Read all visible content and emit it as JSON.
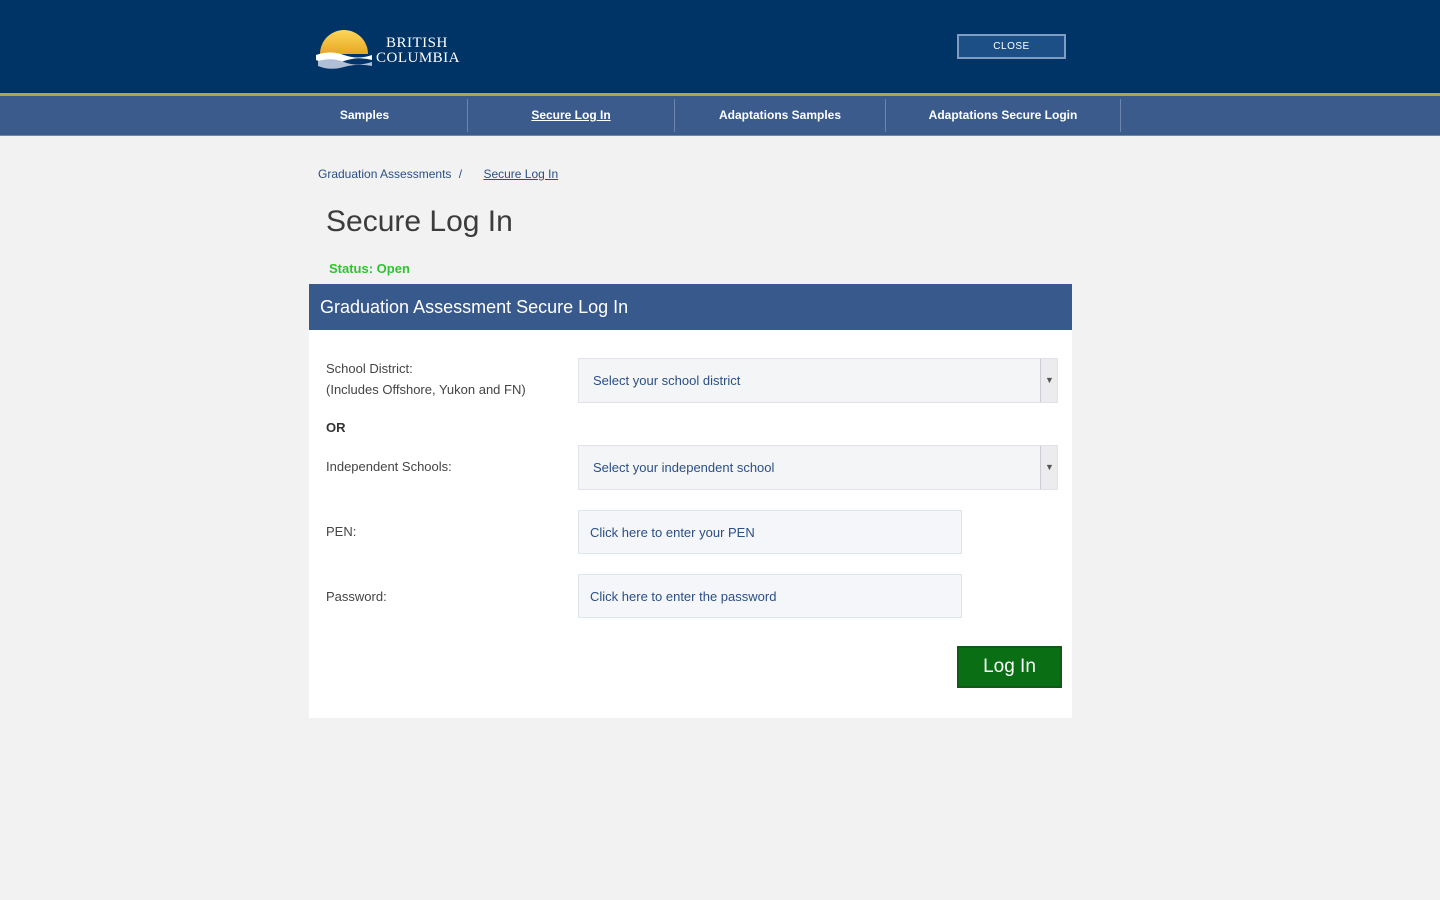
{
  "header": {
    "logo_text_line1": "BRITISH",
    "logo_text_line2": "COLUMBIA",
    "close_label": "CLOSE"
  },
  "nav": {
    "items": [
      {
        "label": "Samples",
        "active": false
      },
      {
        "label": "Secure Log In",
        "active": true
      },
      {
        "label": "Adaptations Samples",
        "active": false
      },
      {
        "label": "Adaptations Secure Login",
        "active": false
      }
    ]
  },
  "breadcrumb": {
    "parent": "Graduation Assessments",
    "separator": "/",
    "current": "Secure Log In"
  },
  "page": {
    "title": "Secure Log In",
    "status": "Status: Open"
  },
  "form": {
    "header": "Graduation Assessment Secure Log In",
    "school_district_label_line1": "School District:",
    "school_district_label_line2": "(Includes Offshore, Yukon and FN)",
    "school_district_value": "Select your school district",
    "or_label": "OR",
    "independent_label": "Independent Schools:",
    "independent_value": "Select your independent school",
    "pen_label": "PEN:",
    "pen_placeholder": "Click here to enter your PEN",
    "password_label": "Password:",
    "password_placeholder": "Click here to enter the password",
    "submit_label": "Log In"
  },
  "colors": {
    "header_bg": "#003366",
    "accent_gold": "#b8a04f",
    "nav_bg": "#3a5b8c",
    "status_green": "#2fc42f",
    "button_green": "#0a6e14"
  }
}
